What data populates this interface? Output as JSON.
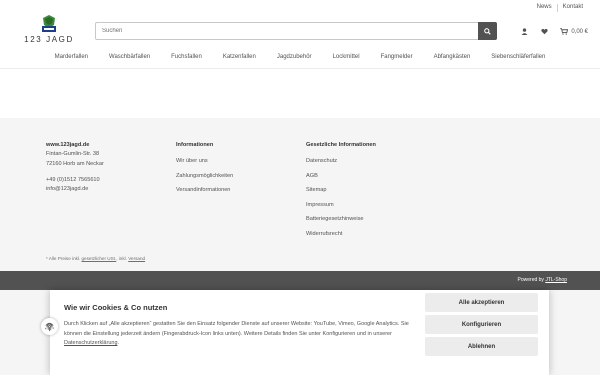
{
  "header": {
    "logo_text": "123 JAGD",
    "search_placeholder": "Suchen",
    "top_links": [
      "News",
      "Kontakt"
    ],
    "cart_total": "0,00 €"
  },
  "nav": {
    "items": [
      "Marderfallen",
      "Waschbärfallen",
      "Fuchsfallen",
      "Katzenfallen",
      "Jagdzubehör",
      "Lockmittel",
      "Fangmelder",
      "Abfangkästen",
      "Siebenschläferfallen"
    ]
  },
  "footer": {
    "contact": {
      "site": "www.123jagd.de",
      "street": "Fintan-Gumlin-Str. 38",
      "city": "72160 Horb am Neckar",
      "phone": "+49 (0)1512 7565610",
      "email": "info@123jagd.de"
    },
    "info": {
      "title": "Informationen",
      "items": [
        "Wir über uns",
        "Zahlungsmöglichkeiten",
        "Versandinformationen"
      ]
    },
    "legal_info": {
      "title": "Gesetzliche Informationen",
      "items": [
        "Datenschutz",
        "AGB",
        "Sitemap",
        "Impressum",
        "Batteriegesetzhinweise",
        "Widerrufsrecht"
      ]
    },
    "price_note_prefix": "* Alle Preise inkl. ",
    "price_note_vat": "gesetzlicher USt.",
    "price_note_mid": ", inkl. ",
    "price_note_shipping": "Versand",
    "powered_prefix": "Powered by ",
    "powered_link": "JTL-Shop"
  },
  "cookie": {
    "title": "Wie wir Cookies & Co nutzen",
    "text_main": "Durch Klicken auf „Alle akzeptieren“ gestatten Sie den Einsatz folgender Dienste auf unserer Website: YouTube, Vimeo, Google Analytics. Sie können die Einstellung jederzeit ändern (Fingerabdruck-Icon links unten). Weitere Details finden Sie unter Konfigurieren und in unserer ",
    "text_link": "Datenschutzerklärung",
    "text_end": ".",
    "buttons": {
      "accept_all": "Alle akzeptieren",
      "configure": "Konfigurieren",
      "reject": "Ablehnen"
    }
  },
  "colors": {
    "dark": "#525252",
    "footer_bg": "#f5f5f5",
    "button_bg": "#ececec",
    "logo_green": "#3b8a3a",
    "logo_blue": "#1c3f8c"
  }
}
